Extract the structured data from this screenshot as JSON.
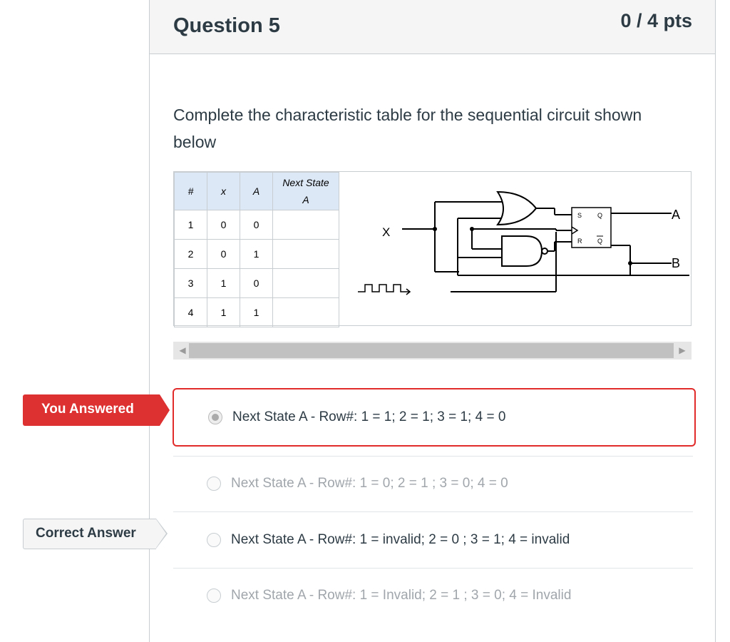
{
  "question": {
    "title": "Question 5",
    "points": "0 / 4 pts",
    "text": "Complete the characteristic table for the sequential circuit shown below"
  },
  "table": {
    "headers": [
      "#",
      "x",
      "A",
      "Next State A"
    ],
    "rows": [
      [
        "1",
        "0",
        "0",
        ""
      ],
      [
        "2",
        "0",
        "1",
        ""
      ],
      [
        "3",
        "1",
        "0",
        ""
      ],
      [
        "4",
        "1",
        "1",
        ""
      ]
    ]
  },
  "circuit": {
    "input_x": "X",
    "output_a": "A",
    "output_b": "B",
    "ff_s": "S",
    "ff_q": "Q",
    "ff_r": "R",
    "ff_qbar": "Q"
  },
  "flags": {
    "you_answered": "You Answered",
    "correct_answer": "Correct Answer"
  },
  "answers": [
    {
      "label": "Next State A - Row#: 1 = 1; 2 = 1; 3 = 1; 4 = 0",
      "state": "selected-incorrect"
    },
    {
      "label": "Next State A - Row#: 1 = 0; 2 = 1 ; 3 = 0; 4 = 0",
      "state": "other"
    },
    {
      "label": "Next State A - Row#: 1 = invalid; 2 = 0 ; 3 = 1; 4 = invalid",
      "state": "correct"
    },
    {
      "label": "Next State A - Row#: 1 = Invalid; 2 = 1 ; 3 = 0; 4 = Invalid",
      "state": "other"
    }
  ],
  "colors": {
    "incorrect": "#dd3031",
    "header_bg": "#f5f5f5",
    "table_header_bg": "#dde8f6"
  }
}
